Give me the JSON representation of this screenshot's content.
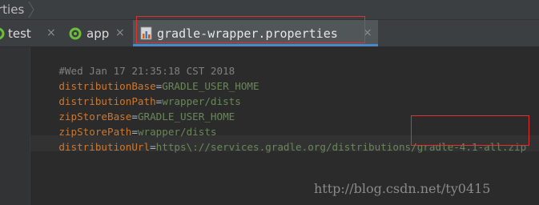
{
  "breadcrumb": {
    "text": "rties"
  },
  "tabs": [
    {
      "label": "test",
      "close": "×"
    },
    {
      "label": "app",
      "close": "×"
    },
    {
      "label": "gradle-wrapper.properties",
      "close": "×"
    }
  ],
  "editor": {
    "lines": [
      {
        "comment": "#Wed Jan 17 21:35:18 CST 2018"
      },
      {
        "key": "distributionBase",
        "eq": "=",
        "value": "GRADLE_USER_HOME"
      },
      {
        "key": "distributionPath",
        "eq": "=",
        "value": "wrapper/dists"
      },
      {
        "key": "zipStoreBase",
        "eq": "=",
        "value": "GRADLE_USER_HOME"
      },
      {
        "key": "zipStorePath",
        "eq": "=",
        "value": "wrapper/dists"
      },
      {
        "key": "distributionUrl",
        "eq": "=",
        "value": "https\\://services.gradle.org/distributions/gradle-4.1-all.zip"
      }
    ]
  },
  "watermark": "http://blog.csdn.net/ty0415",
  "colors": {
    "highlight_box": "#e03131",
    "key": "#cc7832",
    "value": "#6a8759",
    "comment": "#808080",
    "tab_active_underline": "#4a88c7"
  },
  "icons": [
    "chevron-right-icon",
    "android-icon",
    "gradle-file-icon",
    "close-icon"
  ]
}
